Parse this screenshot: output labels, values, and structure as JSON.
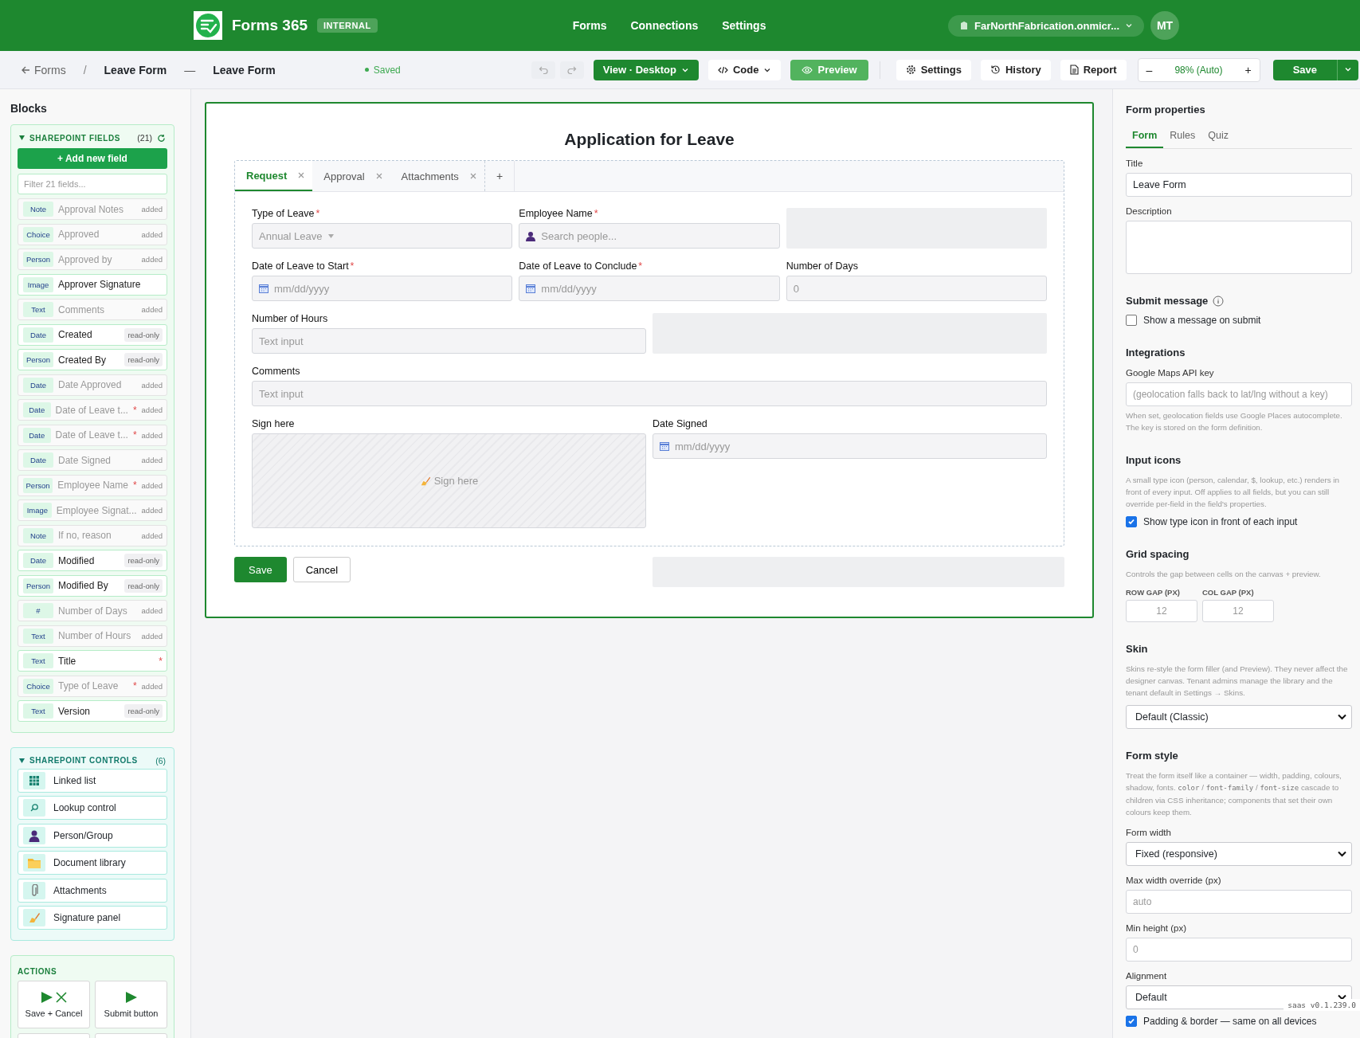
{
  "topbar": {
    "app_name": "Forms 365",
    "env_badge": "INTERNAL",
    "nav": [
      "Forms",
      "Connections",
      "Settings"
    ],
    "tenant": "FarNorthFabrication.onmicr...",
    "avatar": "MT"
  },
  "toolbar": {
    "back": "Forms",
    "separator": "/",
    "form_name": "Leave Form",
    "dash": "—",
    "form_title": "Leave Form",
    "status": "Saved",
    "view": "View · Desktop",
    "code": "Code",
    "preview": "Preview",
    "settings": "Settings",
    "history": "History",
    "report": "Report",
    "zoom_minus": "–",
    "zoom": "98% (Auto)",
    "zoom_plus": "+",
    "save": "Save"
  },
  "sidebar": {
    "title": "Blocks",
    "fields_section": {
      "title": "SHAREPOINT FIELDS",
      "count": "(21)",
      "add_button": "+ Add new field",
      "filter_placeholder": "Filter 21 fields...",
      "items": [
        {
          "type": "Note",
          "name": "Approval Notes",
          "badge": "added",
          "dimmed": true
        },
        {
          "type": "Choice",
          "name": "Approved",
          "badge": "added",
          "dimmed": true
        },
        {
          "type": "Person",
          "name": "Approved by",
          "badge": "added",
          "dimmed": true
        },
        {
          "type": "Image",
          "name": "Approver Signature",
          "dimmed": false
        },
        {
          "type": "Text",
          "name": "Comments",
          "badge": "added",
          "dimmed": true
        },
        {
          "type": "Date",
          "name": "Created",
          "badge": "read-only",
          "dimmed": false
        },
        {
          "type": "Person",
          "name": "Created By",
          "badge": "read-only",
          "dimmed": false
        },
        {
          "type": "Date",
          "name": "Date Approved",
          "badge": "added",
          "dimmed": true
        },
        {
          "type": "Date",
          "name": "Date of Leave t...",
          "required_mark": "*",
          "badge": "added",
          "dimmed": true
        },
        {
          "type": "Date",
          "name": "Date of Leave t...",
          "required_mark": "*",
          "badge": "added",
          "dimmed": true
        },
        {
          "type": "Date",
          "name": "Date Signed",
          "badge": "added",
          "dimmed": true
        },
        {
          "type": "Person",
          "name": "Employee Name",
          "required_mark": "*",
          "badge": "added",
          "dimmed": true
        },
        {
          "type": "Image",
          "name": "Employee Signat...",
          "badge": "added",
          "dimmed": true
        },
        {
          "type": "Note",
          "name": "If no, reason",
          "badge": "added",
          "dimmed": true
        },
        {
          "type": "Date",
          "name": "Modified",
          "badge": "read-only",
          "dimmed": false
        },
        {
          "type": "Person",
          "name": "Modified By",
          "badge": "read-only",
          "dimmed": false
        },
        {
          "type": "#",
          "name": "Number of Days",
          "badge": "added",
          "dimmed": true
        },
        {
          "type": "Text",
          "name": "Number of Hours",
          "badge": "added",
          "dimmed": true
        },
        {
          "type": "Text",
          "name": "Title",
          "required_mark": "*",
          "dimmed": false
        },
        {
          "type": "Choice",
          "name": "Type of Leave",
          "required_mark": "*",
          "badge": "added",
          "dimmed": true
        },
        {
          "type": "Text",
          "name": "Version",
          "badge": "read-only",
          "dimmed": false
        }
      ]
    },
    "controls_section": {
      "title": "SHAREPOINT CONTROLS",
      "count": "(6)",
      "items": [
        {
          "name": "Linked list"
        },
        {
          "name": "Lookup control"
        },
        {
          "name": "Person/Group"
        },
        {
          "name": "Document library"
        },
        {
          "name": "Attachments"
        },
        {
          "name": "Signature panel"
        }
      ]
    },
    "actions_section": {
      "title": "ACTIONS",
      "items": [
        {
          "name": "Save + Cancel"
        },
        {
          "name": "Submit button"
        }
      ]
    }
  },
  "form": {
    "title": "Application for Leave",
    "tabs": [
      {
        "label": "Request",
        "selected": true
      },
      {
        "label": "Approval",
        "selected": false
      },
      {
        "label": "Attachments",
        "selected": false
      }
    ],
    "add_tab": "+",
    "fields": [
      {
        "kind": "select",
        "label": "Type of Leave",
        "required_mark": "*",
        "placeholder": "Annual Leave"
      },
      {
        "kind": "people",
        "label": "Employee Name",
        "required_mark": "*",
        "placeholder": "Search people..."
      },
      {
        "kind": "empty"
      },
      {
        "kind": "date",
        "label": "Date of Leave to Start",
        "required_mark": "*",
        "placeholder": "mm/dd/yyyy"
      },
      {
        "kind": "date",
        "label": "Date of Leave to Conclude",
        "required_mark": "*",
        "placeholder": "mm/dd/yyyy"
      },
      {
        "kind": "text",
        "label": "Number of Days",
        "placeholder": "0"
      },
      {
        "kind": "text",
        "label": "Number of Hours",
        "placeholder": "Text input"
      },
      {
        "kind": "empty"
      },
      {
        "kind": "text",
        "label": "Comments",
        "placeholder": "Text input"
      },
      {
        "kind": "signature",
        "label": "Sign here",
        "placeholder": "Sign here"
      },
      {
        "kind": "date",
        "label": "Date Signed",
        "placeholder": "mm/dd/yyyy"
      }
    ],
    "save": "Save",
    "cancel": "Cancel"
  },
  "properties": {
    "title": "Form properties",
    "tabs": [
      {
        "label": "Form",
        "selected": true
      },
      {
        "label": "Rules",
        "selected": false
      },
      {
        "label": "Quiz",
        "selected": false
      }
    ],
    "blocks": [
      {
        "kind": "label",
        "text": "Title"
      },
      {
        "kind": "input",
        "value": "Leave Form"
      },
      {
        "kind": "label",
        "text": "Description"
      },
      {
        "kind": "textarea"
      },
      {
        "kind": "heading",
        "text": "Submit message",
        "info": true
      },
      {
        "kind": "checkbox",
        "text": "Show a message on submit",
        "checked": false
      },
      {
        "kind": "heading",
        "text": "Integrations"
      },
      {
        "kind": "label",
        "text": "Google Maps API key"
      },
      {
        "kind": "input",
        "placeholder": "(geolocation falls back to lat/lng without a key)"
      },
      {
        "kind": "help",
        "parts": [
          {
            "text": "When set, geolocation fields use Google Places autocomplete. The key is stored on the form definition."
          }
        ]
      },
      {
        "kind": "heading",
        "text": "Input icons"
      },
      {
        "kind": "help",
        "parts": [
          {
            "text": "A small type icon (person, calendar, $, lookup, etc.) renders in front of every input. Off applies to all fields, but you can still override per-field in the field's properties."
          }
        ]
      },
      {
        "kind": "checkbox",
        "text": "Show type icon in front of each input",
        "checked": true
      },
      {
        "kind": "heading",
        "text": "Grid spacing"
      },
      {
        "kind": "help",
        "parts": [
          {
            "text": "Controls the gap between cells on the canvas + preview."
          }
        ]
      },
      {
        "kind": "gaps",
        "items": [
          {
            "label": "ROW GAP (PX)",
            "placeholder": "12"
          },
          {
            "label": "COL GAP (PX)",
            "placeholder": "12"
          }
        ]
      },
      {
        "kind": "heading",
        "text": "Skin"
      },
      {
        "kind": "help",
        "parts": [
          {
            "text": "Skins re-style the form filler (and Preview). They never affect the designer canvas. Tenant admins manage the library and the tenant default in Settings → Skins."
          }
        ]
      },
      {
        "kind": "select",
        "value": "Default (Classic)"
      },
      {
        "kind": "heading",
        "text": "Form style"
      },
      {
        "kind": "help",
        "parts": [
          {
            "text": "Treat the form itself like a container — width, padding, colours, shadow, fonts. "
          },
          {
            "text": "color",
            "code": true
          },
          {
            "text": " / "
          },
          {
            "text": "font-family",
            "code": true
          },
          {
            "text": " / "
          },
          {
            "text": "font-size",
            "code": true
          },
          {
            "text": " cascade to children via CSS inheritance; components that set their own colours keep them."
          }
        ]
      },
      {
        "kind": "label",
        "text": "Form width"
      },
      {
        "kind": "select",
        "value": "Fixed (responsive)"
      },
      {
        "kind": "label",
        "text": "Max width override (px)"
      },
      {
        "kind": "input",
        "placeholder": "auto"
      },
      {
        "kind": "label",
        "text": "Min height (px)"
      },
      {
        "kind": "input",
        "placeholder": "0"
      },
      {
        "kind": "label",
        "text": "Alignment"
      },
      {
        "kind": "select",
        "value": "Default"
      },
      {
        "kind": "checkbox",
        "text": "Padding & border — same on all devices",
        "checked": true
      }
    ],
    "version": "saas v0.1.239.0"
  }
}
